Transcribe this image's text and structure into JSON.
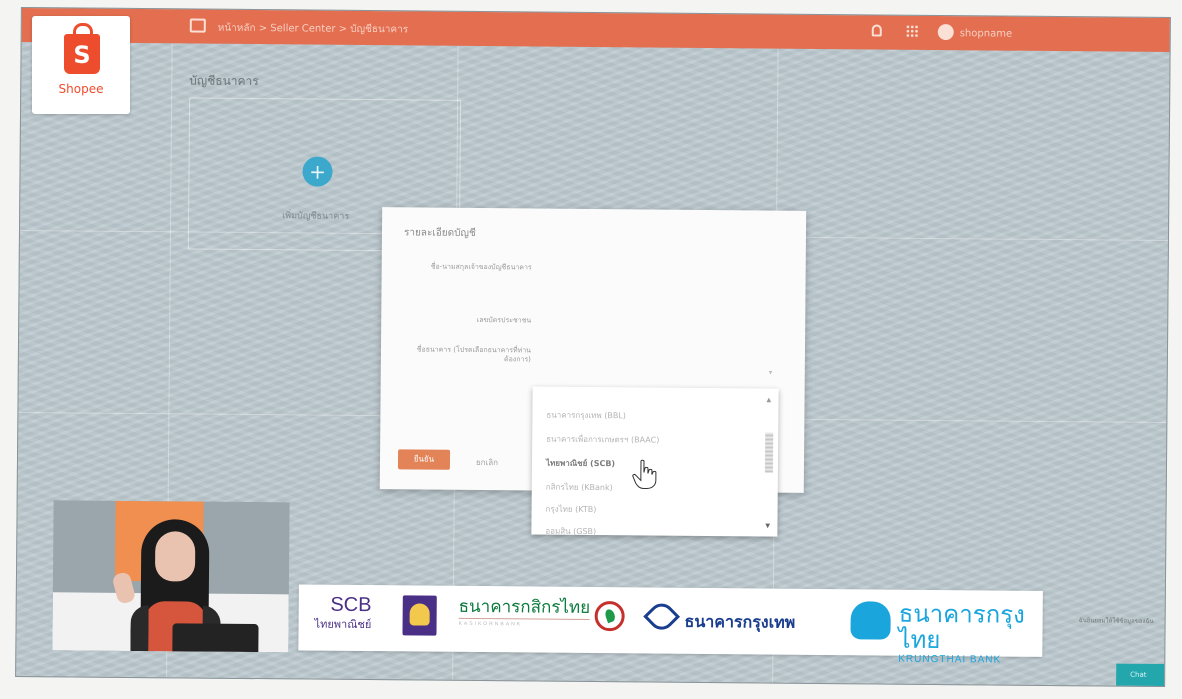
{
  "topbar": {
    "breadcrumb": "หน้าหลัก > Seller Center > บัญชีธนาคาร",
    "username": "shopname"
  },
  "logo": {
    "letter": "S",
    "word": "Shopee"
  },
  "page": {
    "title": "บัญชีธนาคาร",
    "add_icon": "+",
    "add_label": "เพิ่มบัญชีธนาคาร"
  },
  "modal": {
    "title": "รายละเอียดบัญชี",
    "label_account_name": "ชื่อ-นามสกุลเจ้าของบัญชีธนาคาร",
    "label_id": "เลขบัตรประชาชน",
    "label_bank": "ชื่อธนาคาร (โปรดเลือกธนาคารที่ท่านต้องการ)",
    "dropdown_caret": "▾",
    "confirm_label": "ยืนยัน",
    "cancel_label": "ยกเลิก"
  },
  "dropdown": {
    "options": [
      {
        "label": "ธนาคารกรุงเทพ (BBL)",
        "selected": false
      },
      {
        "label": "ธนาคารเพื่อการเกษตรฯ (BAAC)",
        "selected": false
      },
      {
        "label": "ไทยพาณิชย์ (SCB)",
        "selected": true
      },
      {
        "label": "กสิกรไทย (KBank)",
        "selected": false
      },
      {
        "label": "กรุงไทย (KTB)",
        "selected": false
      },
      {
        "label": "ออมสิน (GSB)",
        "selected": false
      }
    ],
    "scroll_up": "▲",
    "scroll_down": "▼"
  },
  "banner": {
    "scb_en": "SCB",
    "scb_th": "ไทยพาณิชย์",
    "kbank_th": "ธนาคารกสิกรไทย",
    "kbank_en": "KASIKORNBANK",
    "bbl_th": "ธนาคารกรุงเทพ",
    "ktb_th": "ธนาคารกรุงไทย",
    "ktb_en": "KRUNGTHAI BANK"
  },
  "side_text": "ฉันยินยอมให้ใช้ข้อมูลของฉัน",
  "chat_label": "Chat",
  "colors": {
    "shopee_orange": "#ee4d2d",
    "topbar": "#e36e50",
    "confirm_button": "#e38358",
    "scb": "#4a2f87",
    "kbank": "#0b7a3c",
    "bbl": "#1a3d8f",
    "ktb": "#1ba5dd"
  }
}
